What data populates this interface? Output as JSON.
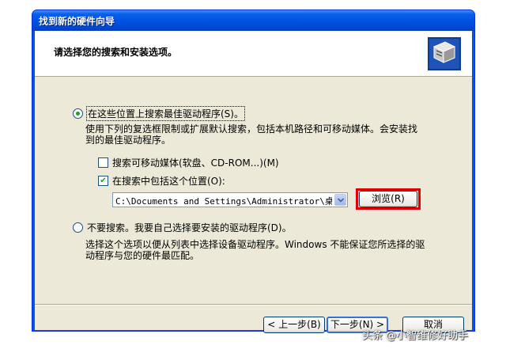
{
  "window": {
    "title": "找到新的硬件向导"
  },
  "header": {
    "title": "请选择您的搜索和安装选项。"
  },
  "option_search": {
    "label": "在这些位置上搜索最佳驱动程序(S)。",
    "description_line1": "使用下列的复选框限制或扩展默认搜索，包括本机路径和可移动媒体。会安装找",
    "description_line2": "到的最佳驱动程序。",
    "selected": true
  },
  "checkbox_removable": {
    "label": "搜索可移动媒体(软盘、CD-ROM...)(M)",
    "checked": false
  },
  "checkbox_location": {
    "label": "在搜索中包括这个位置(O):",
    "checked": true
  },
  "location_combo": {
    "value": "C:\\Documents and Settings\\Administrator\\桌"
  },
  "browse_button": {
    "label": "浏览(R)"
  },
  "option_manual": {
    "label": "不要搜索。我要自己选择要安装的驱动程序(D)。",
    "description_line1": "选择这个选项以便从列表中选择设备驱动程序。Windows 不能保证您所选择的驱",
    "description_line2": "动程序与您的硬件最匹配。",
    "selected": false
  },
  "footer": {
    "back_label": "< 上一步(B)",
    "next_label": "下一步(N) >",
    "cancel_label": "取消"
  },
  "watermark": {
    "text": "头条 @小智维修好助手"
  },
  "colors": {
    "highlight": "#e00000",
    "titlebar": "#0054e3",
    "dialog": "#ece9d8"
  }
}
